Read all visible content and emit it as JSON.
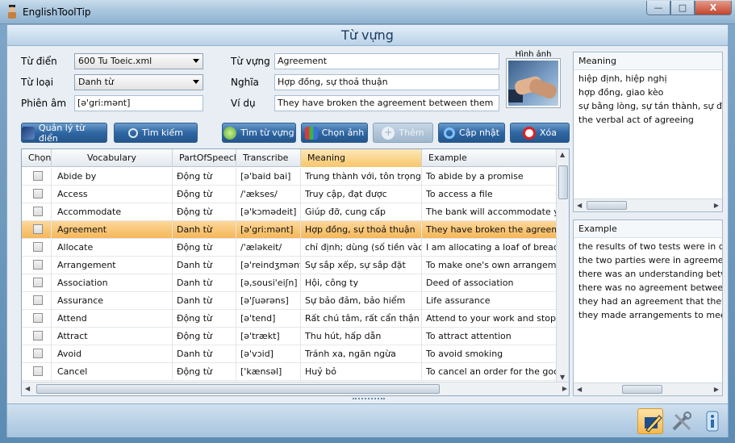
{
  "window": {
    "title": "EnglishToolTip",
    "minimize": "—",
    "maximize": "□",
    "close": "X"
  },
  "header": {
    "title": "Từ vựng"
  },
  "form": {
    "dictionary_label": "Từ điển",
    "dictionary_value": "600 Tu Toeic.xml",
    "wordtype_label": "Từ loại",
    "wordtype_value": "Danh từ",
    "phonetic_label": "Phiên âm",
    "phonetic_value": "[ə'gri:mənt]",
    "vocab_label": "Từ vựng",
    "vocab_value": "Agreement",
    "meaning_label": "Nghĩa",
    "meaning_value": "Hợp đồng, sự thoả thuận",
    "example_label": "Ví dụ",
    "example_value": "They have broken the agreement between them",
    "image_label": "Hình ảnh"
  },
  "toolbar": {
    "manage_dict": "Quản lý từ điển",
    "search": "Tìm kiếm",
    "find_vocab": "Tìm từ vựng",
    "choose_image": "Chọn ảnh",
    "add": "Thêm",
    "update": "Cập nhật",
    "delete": "Xóa"
  },
  "grid": {
    "columns": [
      "Chọn",
      "Vocabulary",
      "PartOfSpeech",
      "Transcribe",
      "Meaning",
      "Example"
    ],
    "rows": [
      [
        "Abide by",
        "Động từ",
        "[ə'baid bai]",
        "Trung thành với, tôn trọng",
        "To abide by a promise"
      ],
      [
        "Access",
        "Động từ",
        "/'ækses/",
        "Truy cập, đạt được",
        "To access a file"
      ],
      [
        "Accommodate",
        "Động từ",
        "[ə'kɔmədeit]",
        "Giúp đỡ, cung cấp",
        "The bank will accommodate you w"
      ],
      [
        "Agreement",
        "Danh từ",
        "[ə'gri:mənt]",
        "Hợp đồng, sự thoả thuận",
        "They have broken the agreement b"
      ],
      [
        "Allocate",
        "Động từ",
        "/'æləkeit/",
        "chỉ định; dùng (số tiền vào ...",
        "I am allocating a loaf of bread to ea"
      ],
      [
        "Arrangement",
        "Danh từ",
        "[ə'reindʒmənt]",
        "Sự sắp xếp, sự sắp đặt",
        "To make one's own arrangements"
      ],
      [
        "Association",
        "Danh từ",
        "[ə,sousi'eiʃn]",
        "Hội, công ty",
        "Deed of association"
      ],
      [
        "Assurance",
        "Danh từ",
        "[ə'ʃuərəns]",
        "Sự bảo đảm, bảo hiểm",
        "Life assurance"
      ],
      [
        "Attend",
        "Động từ",
        "[ə'tend]",
        "Rất chú tâm, rất cẩn thận",
        "Attend to your work and stop talkin"
      ],
      [
        "Attract",
        "Động từ",
        "[ə'trækt]",
        "Thu hút, hấp dẫn",
        "To attract attention"
      ],
      [
        "Avoid",
        "Danh từ",
        "[ə'vɔid]",
        "Tránh xa, ngăn ngừa",
        "To avoid smoking"
      ],
      [
        "Cancel",
        "Động từ",
        "['kænsəl]",
        "Huỷ bỏ",
        "To cancel an order for the goods"
      ]
    ],
    "selected_index": 3
  },
  "meaning_panel": {
    "title": "Meaning",
    "lines": [
      "hiệp định, hiệp nghị",
      "hợp đồng, giao kèo",
      "sự bằng lòng, sự tán thành, sự đồng ý",
      "the verbal act of agreeing"
    ]
  },
  "example_panel": {
    "title": "Example",
    "lines": [
      "the results of two tests were in correspondence",
      "the two parties were in agreement",
      "there was an understanding between",
      "there was no agreement between the",
      "they had an agreement that they would",
      "they made arrangements to meet in Ch"
    ]
  },
  "colors": {
    "accent": "#2f67a3",
    "selected_row": "#f5b75a"
  },
  "icons": [
    "book-icon",
    "magnifier-icon",
    "pen-icon",
    "wrench-icon",
    "info-icon"
  ]
}
